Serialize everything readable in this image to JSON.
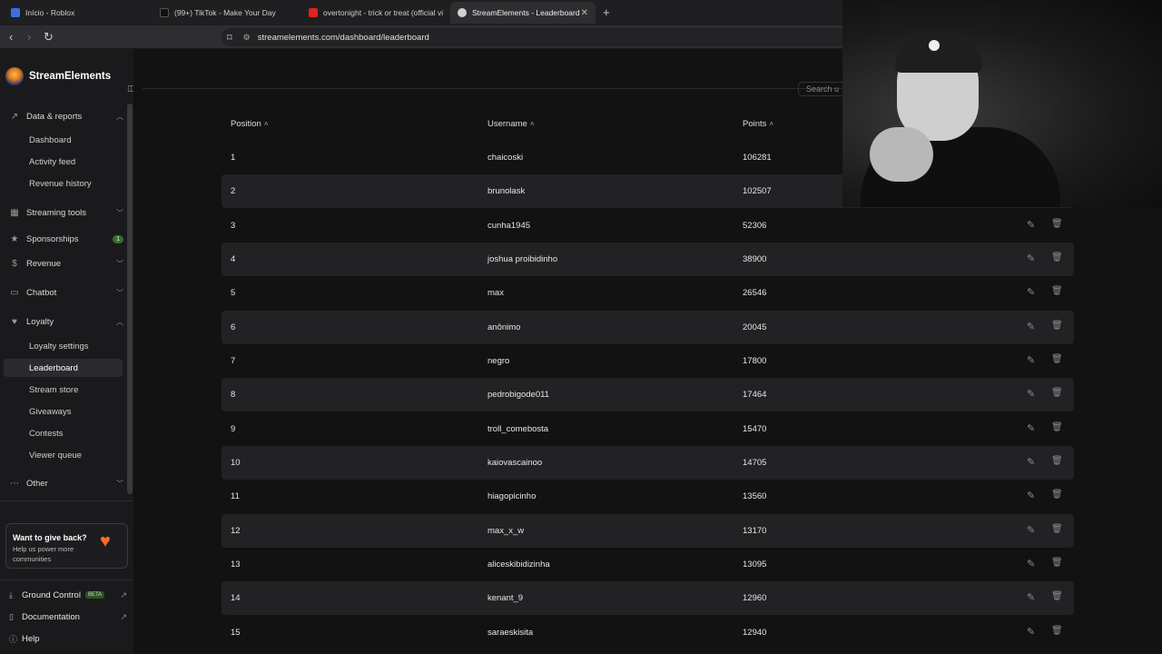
{
  "browser": {
    "tabs": [
      {
        "label": "Início - Roblox",
        "fav_color": "#3d6fe0"
      },
      {
        "label": "(99+) TikTok - Make Your Day",
        "fav_color": "#111111"
      },
      {
        "label": "overtonight - trick or treat (official vi",
        "fav_color": "#e22222"
      },
      {
        "label": "StreamElements - Leaderboard",
        "fav_color": "#d0d0d0"
      }
    ],
    "url": "streamelements.com/dashboard/leaderboard"
  },
  "sidebar": {
    "brand": "StreamElements",
    "sections": {
      "data_reports": "Data & reports",
      "dashboard": "Dashboard",
      "activity_feed": "Activity feed",
      "revenue_history": "Revenue history",
      "streaming_tools": "Streaming tools",
      "sponsorships": "Sponsorships",
      "sponsorships_badge": "1",
      "revenue": "Revenue",
      "chatbot": "Chatbot",
      "loyalty": "Loyalty",
      "loyalty_settings": "Loyalty settings",
      "leaderboard": "Leaderboard",
      "stream_store": "Stream store",
      "giveaways": "Giveaways",
      "contests": "Contests",
      "viewer_queue": "Viewer queue",
      "other": "Other"
    },
    "giveback": {
      "title": "Want to give back?",
      "subtitle": "Help us power more communities"
    },
    "footer": {
      "ground_control": "Ground Control",
      "beta": "BETA",
      "documentation": "Documentation",
      "help": "Help"
    }
  },
  "main": {
    "search_placeholder": "Search u",
    "columns": {
      "position": "Position",
      "username": "Username",
      "points": "Points"
    },
    "rows": [
      {
        "position": "1",
        "username": "chaicoski",
        "points": "106281"
      },
      {
        "position": "2",
        "username": "brunolask",
        "points": "102507"
      },
      {
        "position": "3",
        "username": "cunha1945",
        "points": "52306"
      },
      {
        "position": "4",
        "username": "joshua proibidinho",
        "points": "38900"
      },
      {
        "position": "5",
        "username": "max",
        "points": "26546"
      },
      {
        "position": "6",
        "username": "anônimo",
        "points": "20045"
      },
      {
        "position": "7",
        "username": "negro",
        "points": "17800"
      },
      {
        "position": "8",
        "username": "pedrobigode011",
        "points": "17464"
      },
      {
        "position": "9",
        "username": "troll_comebosta",
        "points": "15470"
      },
      {
        "position": "10",
        "username": "kaiovascainoo",
        "points": "14705"
      },
      {
        "position": "11",
        "username": "hiagopicinho",
        "points": "13560"
      },
      {
        "position": "12",
        "username": "max_x_w",
        "points": "13170"
      },
      {
        "position": "13",
        "username": "aliceskibidizinha",
        "points": "13095"
      },
      {
        "position": "14",
        "username": "kenant_9",
        "points": "12960"
      },
      {
        "position": "15",
        "username": "saraeskisita",
        "points": "12940"
      }
    ]
  }
}
